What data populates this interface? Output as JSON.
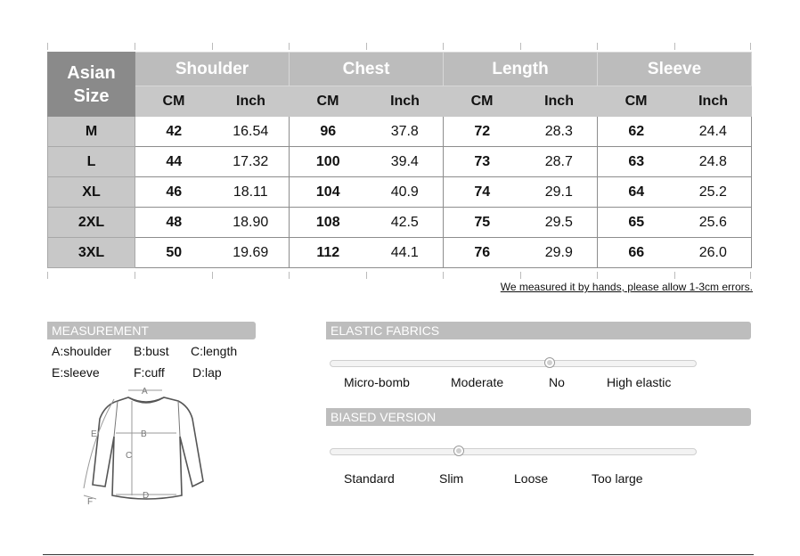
{
  "size_table": {
    "header": {
      "size_label": "Asian Size",
      "groups": [
        "Shoulder",
        "Chest",
        "Length",
        "Sleeve"
      ],
      "units": [
        "CM",
        "Inch"
      ]
    },
    "rows": [
      {
        "size": "M",
        "cells": [
          "42",
          "16.54",
          "96",
          "37.8",
          "72",
          "28.3",
          "62",
          "24.4"
        ]
      },
      {
        "size": "L",
        "cells": [
          "44",
          "17.32",
          "100",
          "39.4",
          "73",
          "28.7",
          "63",
          "24.8"
        ]
      },
      {
        "size": "XL",
        "cells": [
          "46",
          "18.11",
          "104",
          "40.9",
          "74",
          "29.1",
          "64",
          "25.2"
        ]
      },
      {
        "size": "2XL",
        "cells": [
          "48",
          "18.90",
          "108",
          "42.5",
          "75",
          "29.5",
          "65",
          "25.6"
        ]
      },
      {
        "size": "3XL",
        "cells": [
          "50",
          "19.69",
          "112",
          "44.1",
          "76",
          "29.9",
          "66",
          "26.0"
        ]
      }
    ]
  },
  "note": "We measured it by hands, please allow 1-3cm errors.",
  "measurement": {
    "title": "MEASUREMENT",
    "legend": [
      "A:shoulder",
      "B:bust",
      "C:length",
      "E:sleeve",
      "F:cuff",
      "D:lap"
    ],
    "diagram_labels": [
      "A",
      "B",
      "C",
      "D",
      "E",
      "F"
    ]
  },
  "elastic": {
    "title": "ELASTIC FABRICS",
    "options": [
      "Micro-bomb",
      "Moderate",
      "No",
      "High elastic"
    ],
    "selected_fraction": 0.6
  },
  "biased": {
    "title": "BIASED VERSION",
    "options": [
      "Standard",
      "Slim",
      "Loose",
      "Too large"
    ],
    "selected_fraction": 0.35
  },
  "colors": {
    "header_dark": "#8a8a8a",
    "header_light": "#bcbcbc",
    "panel_bar": "#bdbdbd"
  }
}
